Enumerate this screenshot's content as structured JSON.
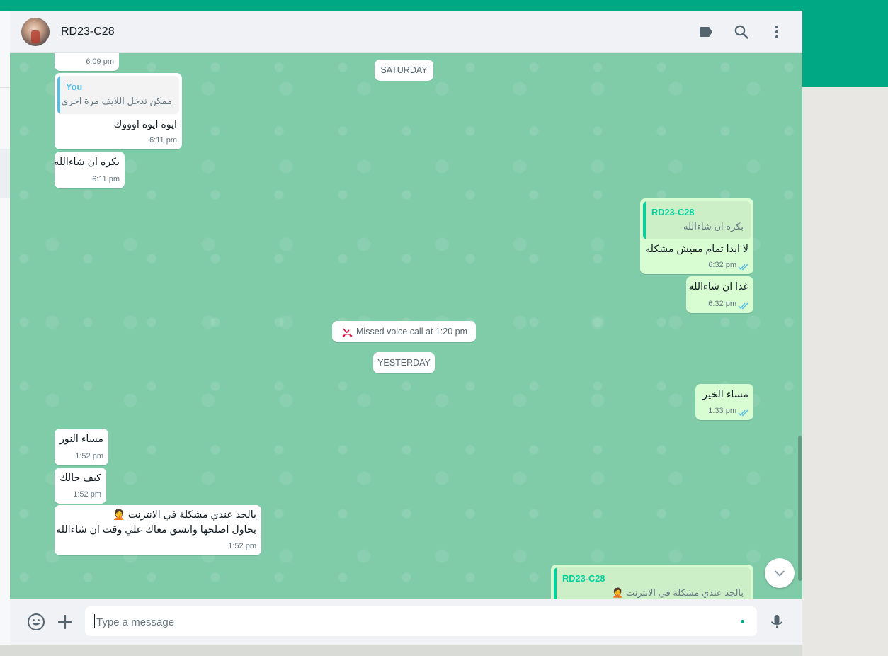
{
  "header": {
    "contact_name": "RD23-C28",
    "icons": [
      "label-icon",
      "search-icon",
      "menu-icon"
    ]
  },
  "colors": {
    "brand": "#00a884",
    "chat_background": "#80cca9",
    "incoming_bubble": "#ffffff",
    "outgoing_bubble": "#d9fdd3",
    "read_ticks": "#53bdeb",
    "missed_call": "#ea0038",
    "quote_you": "#53bdeb",
    "quote_contact": "#06cf9c"
  },
  "dividers": {
    "saturday": "SATURDAY",
    "yesterday": "YESTERDAY"
  },
  "system": {
    "missed_call": "Missed voice call at 1:20 pm"
  },
  "messages": [
    {
      "dir": "in",
      "time": "6:09 pm"
    },
    {
      "dir": "in",
      "quote_name": "You",
      "quote_text": "ممكن تدخل اللايف مرة اخري",
      "text": "ايوة ايوة اوووك",
      "time": "6:11 pm"
    },
    {
      "dir": "in",
      "text": "بكره ان شاءالله",
      "time": "6:11 pm"
    },
    {
      "dir": "out",
      "quote_name": "RD23-C28",
      "quote_text": "بكره ان شاءالله",
      "text": "لا ابدا تمام مفيش مشكله",
      "time": "6:32 pm",
      "status": "read"
    },
    {
      "dir": "out",
      "text": "غدا ان شاءالله",
      "time": "6:32 pm",
      "status": "read"
    },
    {
      "dir": "out",
      "text": "مساء الخير",
      "time": "1:33 pm",
      "status": "read"
    },
    {
      "dir": "in",
      "text": "مساء النور",
      "time": "1:52 pm"
    },
    {
      "dir": "in",
      "text": "كيف حالك",
      "time": "1:52 pm"
    },
    {
      "dir": "in",
      "line1": "بالجد عندي مشكلة في الانترنت 🤦",
      "line2": "بحاول اصلحها وانسق معاك علي وقت ان شاءالله",
      "time": "1:52 pm"
    },
    {
      "dir": "out",
      "quote_name": "RD23-C28",
      "quote_text": "بالجد عندي مشكلة في الانترنت 🤦"
    }
  ],
  "composer": {
    "placeholder": "Type a message",
    "icons": [
      "emoji-icon",
      "attach-plus-icon",
      "microphone-icon"
    ]
  }
}
